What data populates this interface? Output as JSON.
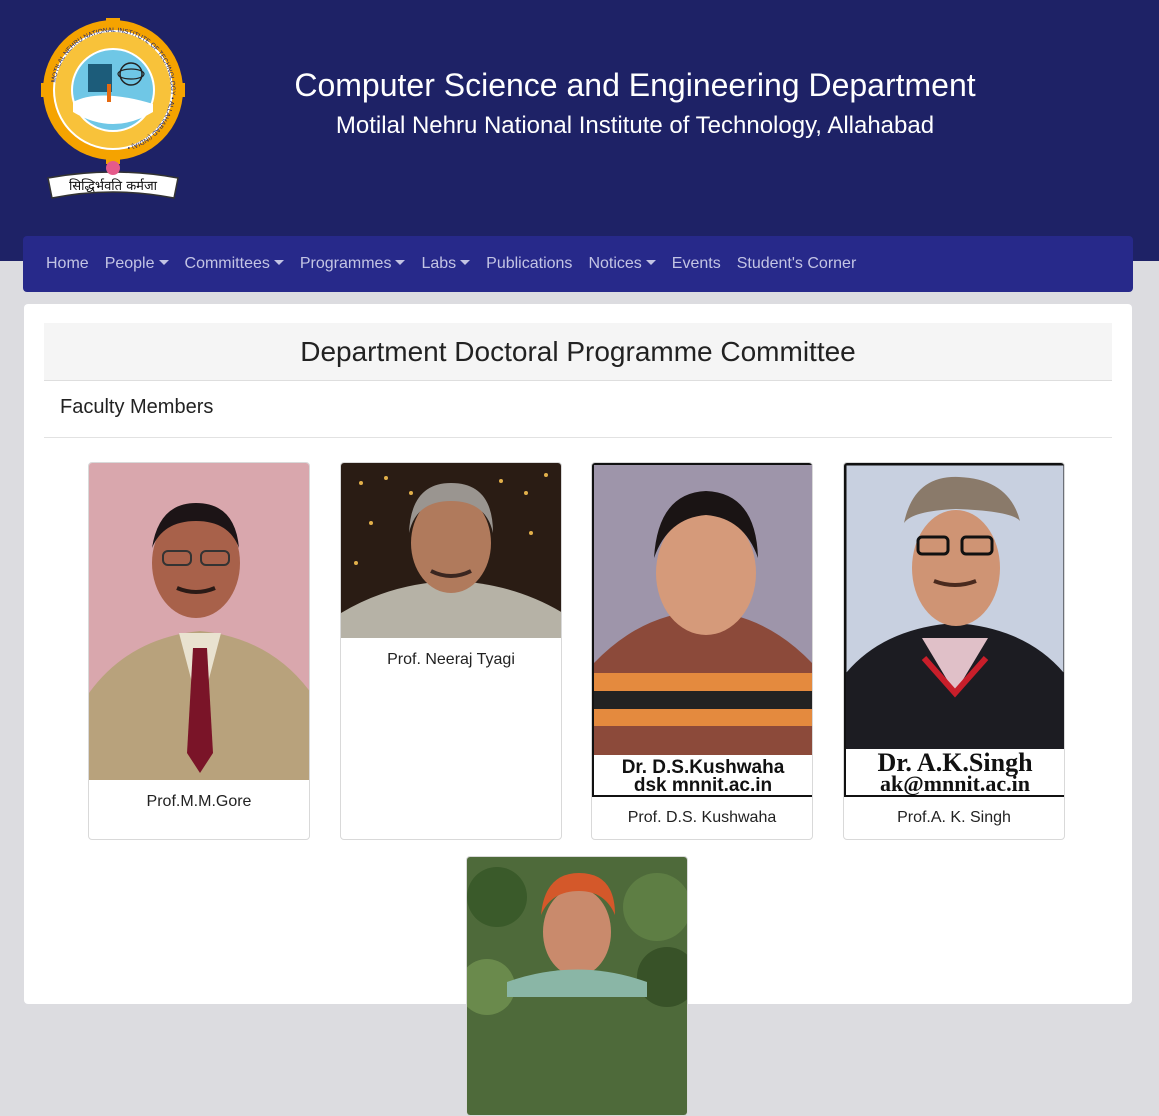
{
  "header": {
    "title": "Computer Science and Engineering Department",
    "subtitle": "Motilal Nehru National Institute of Technology, Allahabad",
    "logo": {
      "motto": "सिद्धिर्भवति कर्मजा",
      "ring_text": "MOTILAL NEHRU NATIONAL INSTITUTE OF TECHNOLOGY • ALLAHABAD (INDIA) •"
    }
  },
  "nav": {
    "items": [
      {
        "label": "Home",
        "dropdown": false
      },
      {
        "label": "People",
        "dropdown": true
      },
      {
        "label": "Committees",
        "dropdown": true
      },
      {
        "label": "Programmes",
        "dropdown": true
      },
      {
        "label": "Labs",
        "dropdown": true
      },
      {
        "label": "Publications",
        "dropdown": false
      },
      {
        "label": "Notices",
        "dropdown": true
      },
      {
        "label": "Events",
        "dropdown": false
      },
      {
        "label": "Student's Corner",
        "dropdown": false
      }
    ]
  },
  "committee": {
    "title": "Department Doctoral Programme Committee",
    "section": "Faculty Members",
    "members": [
      {
        "name": "Prof.M.M.Gore"
      },
      {
        "name": "Prof. Neeraj Tyagi"
      },
      {
        "name": "Prof. D.S. Kushwaha",
        "photo_caption_line1": "Dr. D.S.Kushwaha",
        "photo_caption_line2": "dsk mnnit.ac.in"
      },
      {
        "name": "Prof.A. K. Singh",
        "photo_caption_line1": "Dr. A.K.Singh",
        "photo_caption_line2": "ak@mnnit.ac.in"
      }
    ]
  },
  "colors": {
    "header_bg": "#1e2266",
    "navbar_bg": "#27298a",
    "nav_text": "#c3c4e4",
    "page_bg": "#dcdce0"
  }
}
